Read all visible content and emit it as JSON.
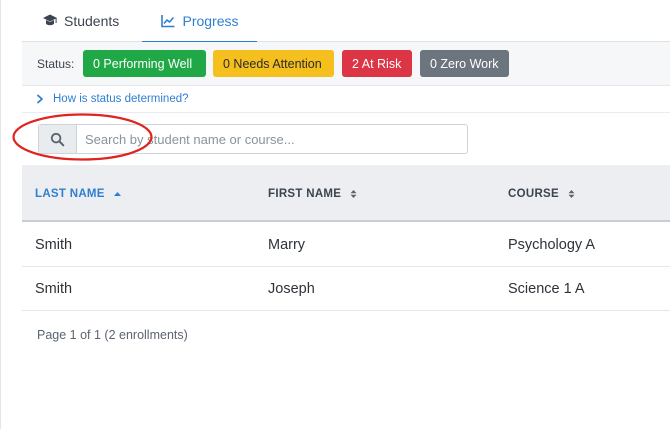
{
  "tabs": [
    {
      "label": "Students",
      "icon": "graduation-cap-icon"
    },
    {
      "label": "Progress",
      "icon": "line-chart-icon",
      "active": true
    }
  ],
  "status": {
    "label": "Status:",
    "badges": [
      {
        "text": "0 Performing Well",
        "color": "#21a846"
      },
      {
        "text": "0 Needs Attention",
        "color": "#f5bf1e"
      },
      {
        "text": "2 At Risk",
        "color": "#dc3545"
      },
      {
        "text": "0 Zero Work",
        "color": "#6c757d"
      }
    ]
  },
  "how_status": {
    "label": "How is status determined?",
    "icon": "chevron-right-icon"
  },
  "search": {
    "placeholder": "Search by student name or course...",
    "value": "",
    "icon": "search-icon"
  },
  "table": {
    "columns": [
      {
        "label": "LAST NAME",
        "sort": "ascending"
      },
      {
        "label": "FIRST NAME",
        "sort": "none"
      },
      {
        "label": "COURSE",
        "sort": "none"
      }
    ],
    "rows": [
      {
        "last": "Smith",
        "first": "Marry",
        "course": "Psychology A"
      },
      {
        "last": "Smith",
        "first": "Joseph",
        "course": "Science 1 A"
      }
    ]
  },
  "pagination": {
    "text": "Page 1 of 1 (2 enrollments)"
  },
  "colors": {
    "accent": "#2f7fd0",
    "annotation": "#e0231f"
  }
}
